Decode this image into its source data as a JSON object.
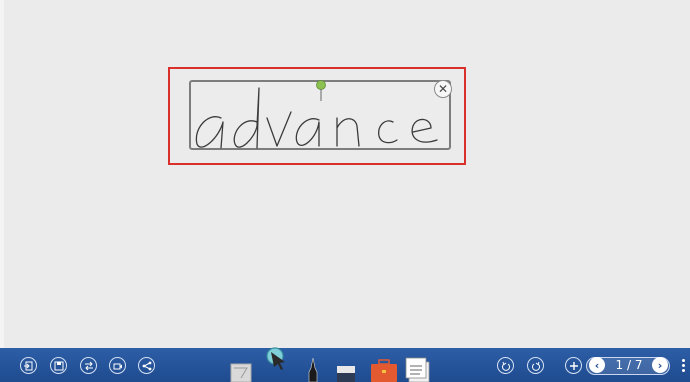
{
  "canvas": {
    "handwriting_text": "advance",
    "selection_color": "#d9302c",
    "pin_color": "#8cc152"
  },
  "toolbar": {
    "background": "#2157a0",
    "left_buttons": [
      {
        "name": "import-icon"
      },
      {
        "name": "save-icon"
      },
      {
        "name": "switch-icon"
      },
      {
        "name": "record-icon"
      },
      {
        "name": "share-icon"
      }
    ],
    "center_tools": [
      {
        "name": "background-tool-icon"
      },
      {
        "name": "select-tool-icon"
      },
      {
        "name": "pen-tool-icon"
      },
      {
        "name": "eraser-tool-icon"
      },
      {
        "name": "toolbox-icon"
      },
      {
        "name": "notes-icon"
      }
    ],
    "right_buttons": [
      {
        "name": "undo-icon"
      },
      {
        "name": "redo-icon"
      },
      {
        "name": "add-page-icon"
      }
    ],
    "page": {
      "current_label": "1 / 7",
      "prev_symbol": "‹",
      "next_symbol": "›"
    }
  }
}
